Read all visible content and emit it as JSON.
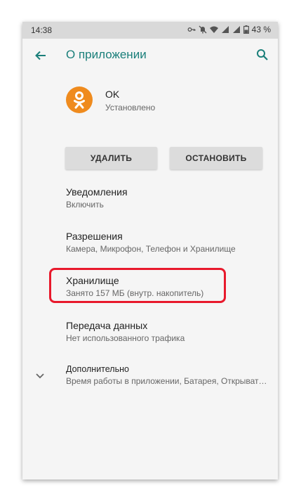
{
  "status_bar": {
    "time": "14:38",
    "battery": "43 %",
    "icons": [
      "key-icon",
      "mute-icon",
      "wifi-icon",
      "signal-icon",
      "signal-icon",
      "battery-icon"
    ]
  },
  "app_bar": {
    "title": "О приложении"
  },
  "app": {
    "name": "OK",
    "status": "Установлено",
    "icon_color": "#ef8b1e"
  },
  "buttons": {
    "uninstall": "УДАЛИТЬ",
    "stop": "ОСТАНОВИТЬ"
  },
  "items": [
    {
      "title": "Уведомления",
      "subtitle": "Включить"
    },
    {
      "title": "Разрешения",
      "subtitle": "Камера, Микрофон, Телефон и Хранилище"
    },
    {
      "title": "Хранилище",
      "subtitle": "Занято 157 МБ (внутр. накопитель)"
    },
    {
      "title": "Передача данных",
      "subtitle": "Нет использованного трафика"
    },
    {
      "title": "Дополнительно",
      "subtitle": "Время работы в приложении, Батарея, Открыват…"
    }
  ],
  "colors": {
    "accent": "#1a7f7a",
    "highlight": "#e8192c"
  }
}
